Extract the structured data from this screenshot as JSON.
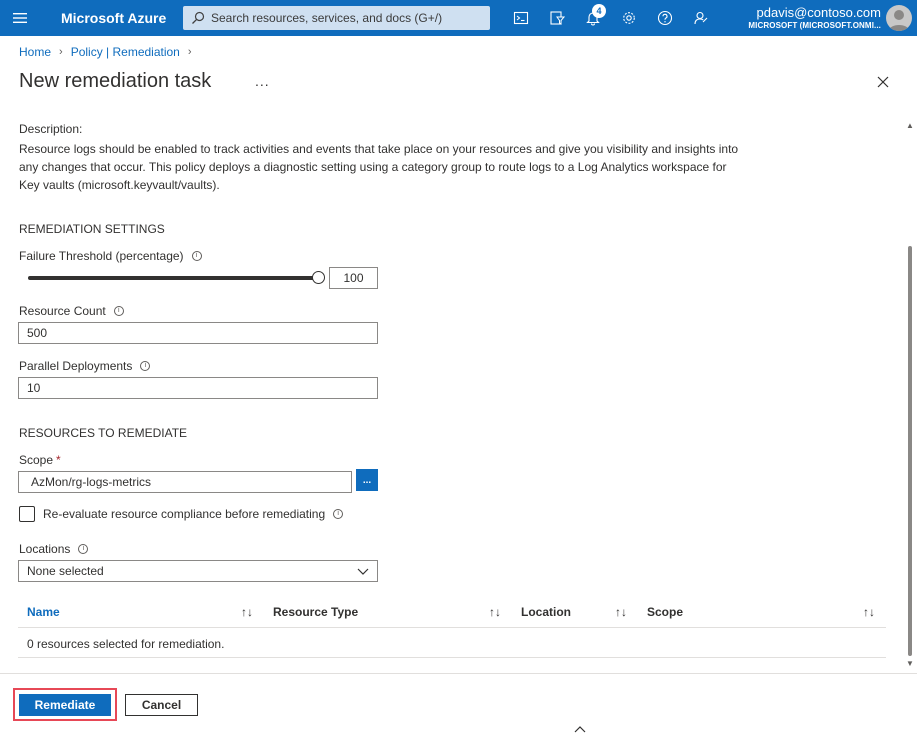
{
  "topbar": {
    "brand": "Microsoft Azure",
    "search_placeholder": "Search resources, services, and docs (G+/)",
    "notification_count": "4",
    "user": "pdavis@contoso.com",
    "tenant": "MICROSOFT (MICROSOFT.ONMI...",
    "icons": [
      "hamburger-icon",
      "search-icon",
      "cloud-shell-icon",
      "directory-filter-icon",
      "notifications-icon",
      "settings-icon",
      "help-icon",
      "feedback-icon",
      "avatar"
    ]
  },
  "breadcrumb": [
    "Home",
    "Policy | Remediation"
  ],
  "page": {
    "title": "New remediation task",
    "more": "..."
  },
  "description": {
    "label": "Description:",
    "text": "Resource logs should be enabled to track activities and events that take place on your resources and give you visibility and insights into any changes that occur. This policy deploys a diagnostic setting using a category group to route logs to a Log Analytics workspace for Key vaults (microsoft.keyvault/vaults)."
  },
  "remediation_settings": {
    "heading": "REMEDIATION SETTINGS",
    "failure_threshold_label": "Failure Threshold (percentage)",
    "failure_threshold_value": "100",
    "failure_threshold_percent": 100,
    "resource_count_label": "Resource Count",
    "resource_count_value": "500",
    "parallel_deployments_label": "Parallel Deployments",
    "parallel_deployments_value": "10"
  },
  "resources": {
    "heading": "RESOURCES TO REMEDIATE",
    "scope_label": "Scope",
    "scope_required": "*",
    "scope_value": "AzMon/rg-logs-metrics",
    "scope_button": "...",
    "reevaluate_label": "Re-evaluate resource compliance before remediating",
    "reevaluate_checked": false,
    "locations_label": "Locations",
    "locations_value": "None selected"
  },
  "table": {
    "columns": [
      "Name",
      "Resource Type",
      "Location",
      "Scope"
    ],
    "sort_glyph": "↑↓",
    "empty_message": "0 resources selected for remediation."
  },
  "footer": {
    "remediate_label": "Remediate",
    "cancel_label": "Cancel"
  },
  "colors": {
    "accent": "#0f6cbd",
    "highlight": "#e74856"
  }
}
